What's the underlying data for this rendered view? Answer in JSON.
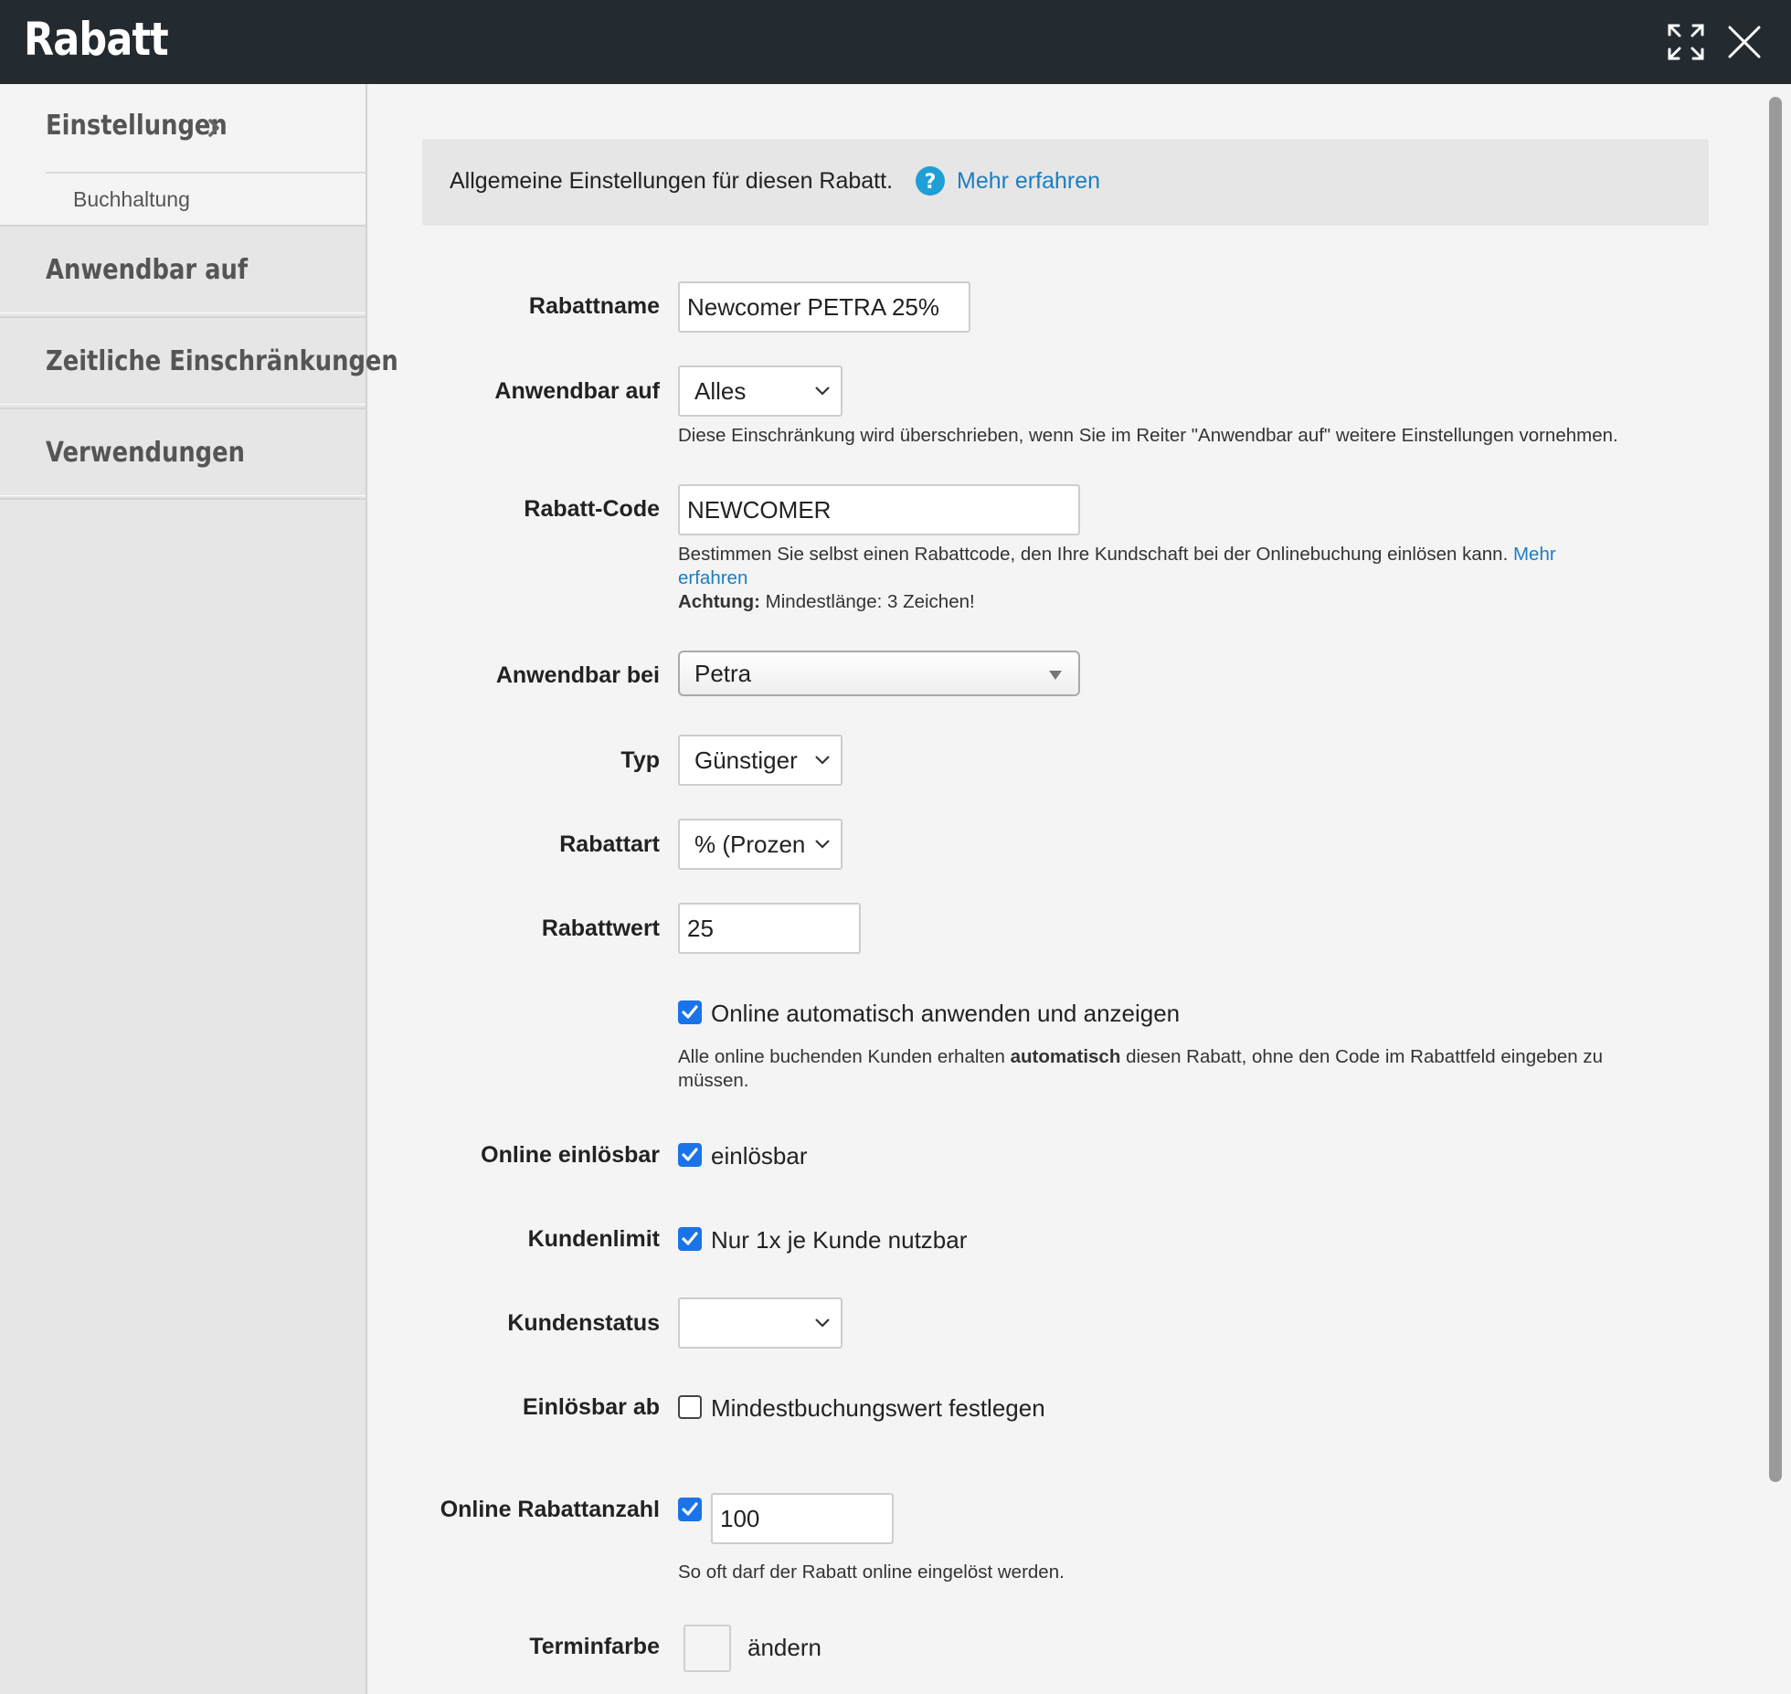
{
  "window": {
    "title": "Rabatt"
  },
  "sidebar": {
    "settings_label": "Einstellungen",
    "sub_item": "Buchhaltung",
    "items": [
      {
        "label": "Anwendbar auf"
      },
      {
        "label": "Zeitliche Einschränkungen"
      },
      {
        "label": "Verwendungen"
      }
    ]
  },
  "info": {
    "text": "Allgemeine Einstellungen für diesen Rabatt.",
    "link": "Mehr erfahren"
  },
  "form": {
    "rabattname": {
      "label": "Rabattname",
      "value": "Newcomer PETRA 25%"
    },
    "anwendbar_auf": {
      "label": "Anwendbar auf",
      "value": "Alles",
      "hint": "Diese Einschränkung wird überschrieben, wenn Sie im Reiter \"Anwendbar auf\" weitere Einstellungen vornehmen."
    },
    "rabatt_code": {
      "label": "Rabatt-Code",
      "value": "NEWCOMER",
      "hint_text": "Bestimmen Sie selbst einen Rabattcode, den Ihre Kundschaft bei der Onlinebuchung einlösen kann.",
      "hint_link_1": "Mehr",
      "hint_link_2": "erfahren",
      "warning_bold": "Achtung:",
      "warning_text": "Mindestlänge: 3 Zeichen!"
    },
    "anwendbar_bei": {
      "label": "Anwendbar bei",
      "value": "Petra"
    },
    "typ": {
      "label": "Typ",
      "value": "Günstiger"
    },
    "rabattart": {
      "label": "Rabattart",
      "value": "% (Prozen"
    },
    "rabattwert": {
      "label": "Rabattwert",
      "value": "25"
    },
    "auto_apply": {
      "checked": true,
      "label": "Online automatisch anwenden und anzeigen",
      "hint_1": "Alle online buchenden Kunden erhalten",
      "hint_bold": "automatisch",
      "hint_2": "diesen Rabatt, ohne den Code im Rabattfeld eingeben zu",
      "hint_3": "müssen."
    },
    "online_einloesbar": {
      "label": "Online einlösbar",
      "checked": true,
      "checkbox_label": "einlösbar"
    },
    "kundenlimit": {
      "label": "Kundenlimit",
      "checked": true,
      "checkbox_label": "Nur 1x je Kunde nutzbar"
    },
    "kundenstatus": {
      "label": "Kundenstatus",
      "value": ""
    },
    "einloesbar_ab": {
      "label": "Einlösbar ab",
      "checked": false,
      "checkbox_label": "Mindestbuchungswert festlegen"
    },
    "online_rabattanzahl": {
      "label": "Online Rabattanzahl",
      "checked": true,
      "value": "100",
      "hint": "So oft darf der Rabatt online eingelöst werden."
    },
    "terminfarbe": {
      "label": "Terminfarbe",
      "link": "ändern",
      "color": "#f4f4f4"
    }
  },
  "colors": {
    "titlebar": "#242b30",
    "accent_link": "#1a7fc1",
    "checkbox": "#1a73e8",
    "help_icon": "#1e9fd6"
  }
}
